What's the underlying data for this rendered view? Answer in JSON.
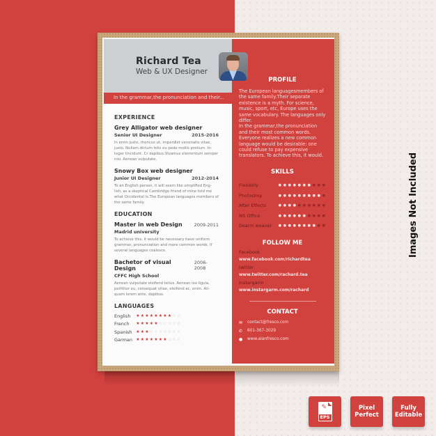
{
  "colors": {
    "accent": "#d1423f",
    "header_gray": "#cdd0d3",
    "kraft": "#c9a87d"
  },
  "resume": {
    "name": "Richard Tea",
    "job_title": "Web & UX Designer",
    "banner_text": "In the grammar,the pronunciation and their...",
    "photo": "portrait-photo",
    "experience": {
      "title": "EXPERIENCE",
      "items": [
        {
          "company": "Grey Alligator web designer",
          "role": "Senior UI Designer",
          "dates": "2015-2016",
          "description": "In enim justo, rhoncus ut, imperdiet venenatis vitae, justo. Nullam dictum felis eu pede mollis pretium. In-teger tincidunt. Cr dapibus.Vivamus elementum semper nisi. Aenean vulputate."
        },
        {
          "company": "Snowy Box web designer",
          "role": "Junior UI Designer",
          "dates": "2012-2014",
          "description": "To an English person, it will seem like simplified Eng-lish, as a skeptical Cambridge friend of mine told me what Occidental is.The European languages members of the same family."
        }
      ]
    },
    "education": {
      "title": "EDUCATION",
      "items": [
        {
          "degree": "Master in web Design",
          "dates": "2009-2011",
          "school": "Madrid university",
          "description": "To achieve this, it would be necessary  have uniform grammar, pronunciation and more common words. If several languages coalesce."
        },
        {
          "degree": "Bachetor of visual Design",
          "dates": "2006-2008",
          "school": "CFFC High School",
          "description": "Aenean vulputate eleifend tellus. Aenean leo ligula, porttitor eu, consequat vitae, eleifend ac, enim. Ali-quam lorem ante, dapibus."
        }
      ]
    },
    "languages": {
      "title": "LANGUAGES",
      "max": 10,
      "items": [
        {
          "name": "English",
          "level": 8
        },
        {
          "name": "French",
          "level": 5
        },
        {
          "name": "Spanish",
          "level": 3
        },
        {
          "name": "Garman",
          "level": 7
        }
      ]
    },
    "profile": {
      "title": "PROFILE",
      "text": "The European languagesmembers of the same family.Their separate existence is a myth. For science, music, sport, etc, Europe uses the same vocabulary. The languages only differ.\nIn the grammar,the pronunciation and their most common words. Everyone realizes a new common language would be desirable: one could refuse to pay expensive translators. To achieve this, it would."
    },
    "skills": {
      "title": "SKILLS",
      "max": 10,
      "items": [
        {
          "name": "Flexibiliy",
          "level": 7
        },
        {
          "name": "Photoshop",
          "level": 9
        },
        {
          "name": "After Effects",
          "level": 4
        },
        {
          "name": "MS Office",
          "level": 6
        },
        {
          "name": "Dearm weaver",
          "level": 8
        }
      ]
    },
    "follow": {
      "title": "FOLLOW ME",
      "items": [
        {
          "label": "Facebook",
          "url": "www.facebook.com/richardtea"
        },
        {
          "label": "twitter",
          "url": "www.twitter.com/rachard.tea"
        },
        {
          "label": "Instargarm",
          "url": "www.instargarm.com/rachard"
        }
      ]
    },
    "contact": {
      "title": "CONTACT",
      "items": [
        {
          "icon": "email-icon",
          "glyph": "✉",
          "value": "contact@fresco.com"
        },
        {
          "icon": "phone-icon",
          "glyph": "✆",
          "value": "601-367-3029"
        },
        {
          "icon": "globe-icon",
          "glyph": "●",
          "value": "www.alanfresco.com"
        }
      ]
    }
  },
  "side_note": "Images Not Included",
  "badges": [
    {
      "name": "eps-badge",
      "label": "EPS"
    },
    {
      "name": "pixel-perfect-badge",
      "line1": "Pixel",
      "line2": "Perfect"
    },
    {
      "name": "fully-editable-badge",
      "line1": "Fully",
      "line2": "Editable"
    }
  ]
}
